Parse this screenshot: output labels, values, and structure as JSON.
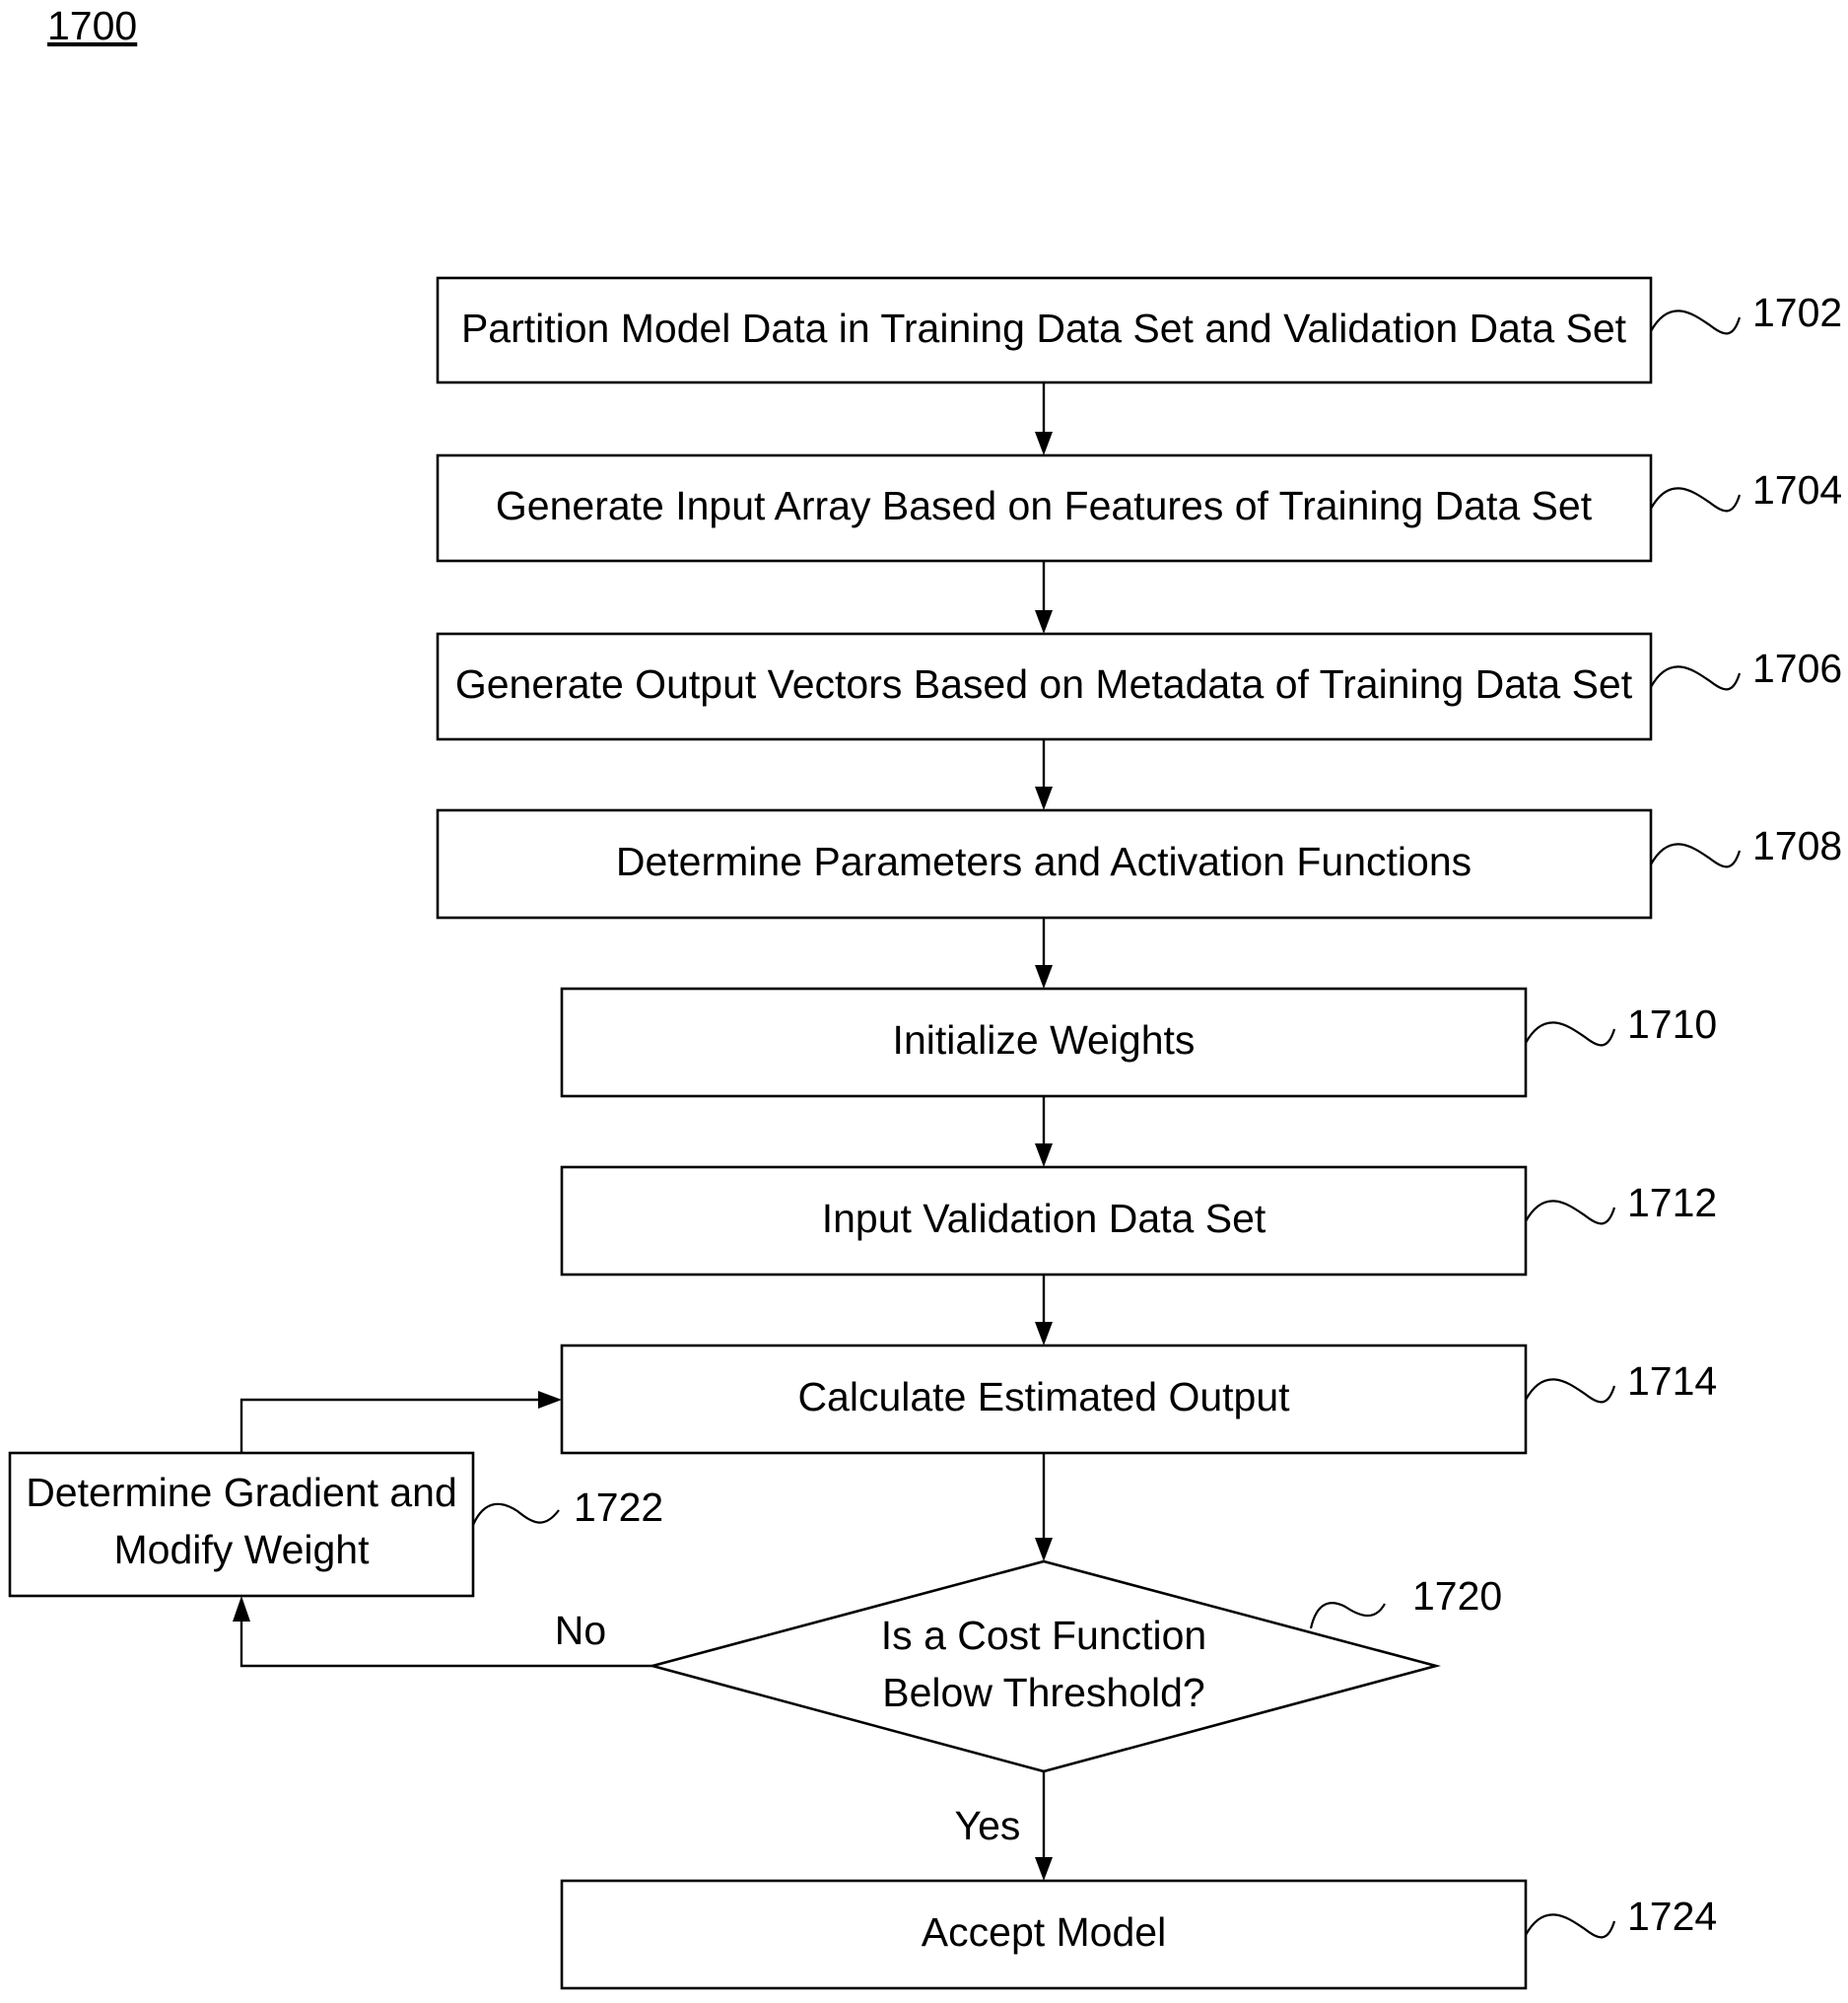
{
  "figure": {
    "number": "1700"
  },
  "steps": [
    {
      "id": "1702",
      "text": "Partition Model Data in Training Data Set and Validation Data Set"
    },
    {
      "id": "1704",
      "text": "Generate Input Array Based on Features of Training Data Set"
    },
    {
      "id": "1706",
      "text": "Generate Output Vectors Based on Metadata of Training Data Set"
    },
    {
      "id": "1708",
      "text": "Determine Parameters and Activation Functions"
    },
    {
      "id": "1710",
      "text": "Initialize Weights"
    },
    {
      "id": "1712",
      "text": "Input Validation Data Set"
    },
    {
      "id": "1714",
      "text": "Calculate Estimated Output"
    },
    {
      "id": "1724",
      "text": "Accept Model"
    }
  ],
  "decision": {
    "id": "1720",
    "line1": "Is a Cost Function",
    "line2": "Below Threshold?",
    "yes_label": "Yes",
    "no_label": "No"
  },
  "loop_step": {
    "id": "1722",
    "line1": "Determine Gradient and",
    "line2": "Modify Weight"
  }
}
